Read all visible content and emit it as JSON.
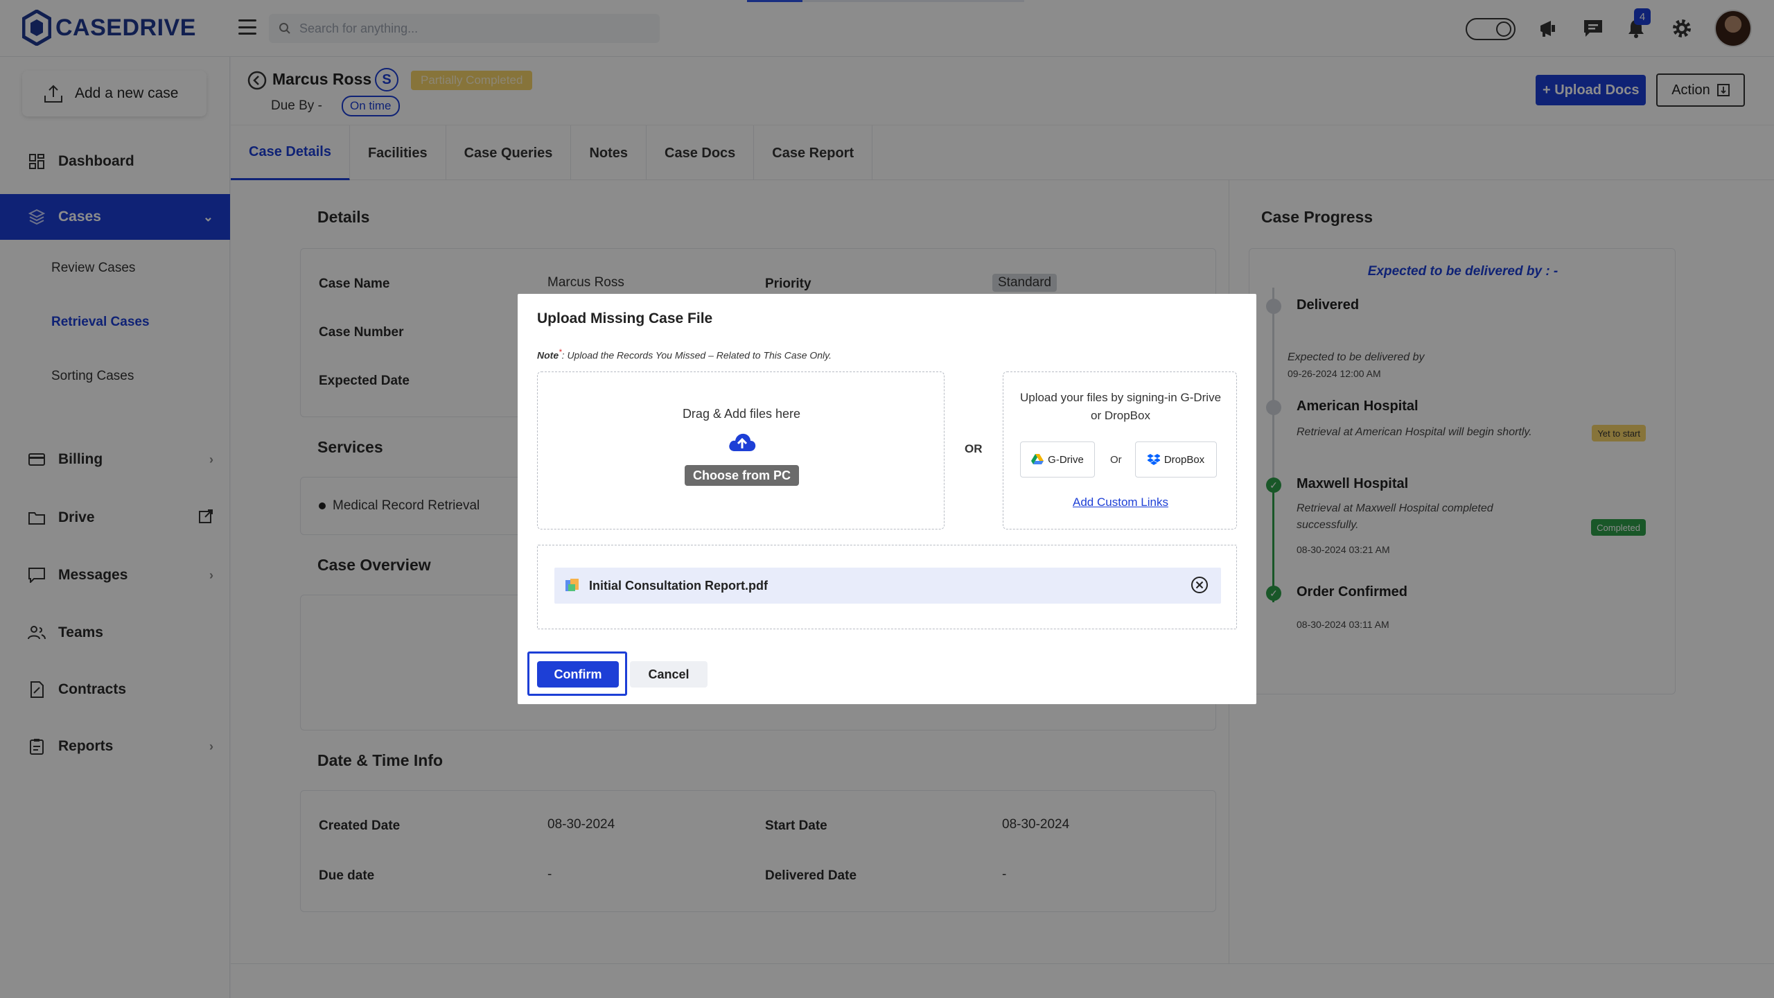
{
  "app": {
    "name": "CASEDRIVE"
  },
  "search": {
    "placeholder": "Search for anything..."
  },
  "notifications": {
    "count": "4"
  },
  "sidebar": {
    "add_case": "Add a new case",
    "items": [
      {
        "label": "Dashboard",
        "icon": "dashboard-icon"
      },
      {
        "label": "Cases",
        "icon": "layers-icon"
      },
      {
        "label": "Billing",
        "icon": "billing-icon"
      },
      {
        "label": "Drive",
        "icon": "folder-icon"
      },
      {
        "label": "Messages",
        "icon": "message-icon"
      },
      {
        "label": "Teams",
        "icon": "team-icon"
      },
      {
        "label": "Contracts",
        "icon": "contract-icon"
      },
      {
        "label": "Reports",
        "icon": "report-icon"
      }
    ],
    "sub_items": [
      "Review Cases",
      "Retrieval Cases",
      "Sorting Cases"
    ]
  },
  "case": {
    "name": "Marcus Ross",
    "initial": "S",
    "status": "Partially Completed",
    "due_by": "Due By -",
    "due_status": "On time",
    "upload_docs": "+ Upload Docs",
    "action": "Action"
  },
  "tabs": [
    "Case Details",
    "Facilities",
    "Case Queries",
    "Notes",
    "Case Docs",
    "Case Report"
  ],
  "details": {
    "title": "Details",
    "case_name_label": "Case Name",
    "case_name_value": "Marcus  Ross",
    "priority_label": "Priority",
    "priority_value": "Standard",
    "case_number_label": "Case Number",
    "expected_date_label": "Expected Date"
  },
  "services": {
    "title": "Services",
    "item": "Medical Record Retrieval"
  },
  "overview": {
    "title": "Case Overview"
  },
  "datetime": {
    "title": "Date & Time Info",
    "created_label": "Created Date",
    "created_value": "08-30-2024",
    "start_label": "Start Date",
    "start_value": "08-30-2024",
    "due_label": "Due date",
    "due_value": "-",
    "delivered_label": "Delivered Date",
    "delivered_value": "-"
  },
  "progress": {
    "title": "Case Progress",
    "expected": "Expected to be delivered by : -",
    "delivered": "Delivered",
    "delivered_note": "Expected to be delivered by",
    "delivered_date": "09-26-2024 12:00 AM",
    "american_title": "American Hospital",
    "american_text": "Retrieval at American Hospital will begin shortly.",
    "american_badge": "Yet to start",
    "maxwell_title": "Maxwell Hospital",
    "maxwell_text_1": "Retrieval at Maxwell Hospital completed",
    "maxwell_text_2": "successfully.",
    "maxwell_badge": "Completed",
    "maxwell_date": "08-30-2024 03:21 AM",
    "confirmed_title": "Order Confirmed",
    "confirmed_date": "08-30-2024 03:11 AM"
  },
  "modal": {
    "title": "Upload Missing Case File",
    "note_label": "Note",
    "note_text": ": Upload the Records You Missed – Related to This Case Only.",
    "drag_text": "Drag & Add files here",
    "choose_pc": "Choose from PC",
    "or": "OR",
    "cloud_text": "Upload your files by signing-in G-Drive or DropBox",
    "gdrive": "G-Drive",
    "or_small": "Or",
    "dropbox": "DropBox",
    "custom_links": "Add Custom Links",
    "file_name": "Initial Consultation Report.pdf",
    "confirm": "Confirm",
    "cancel": "Cancel"
  },
  "colors": {
    "primary": "#1d3fd6",
    "success": "#2e9e4a",
    "warning": "#f6d46a",
    "overlay": "rgba(0,0,0,0.45)"
  }
}
